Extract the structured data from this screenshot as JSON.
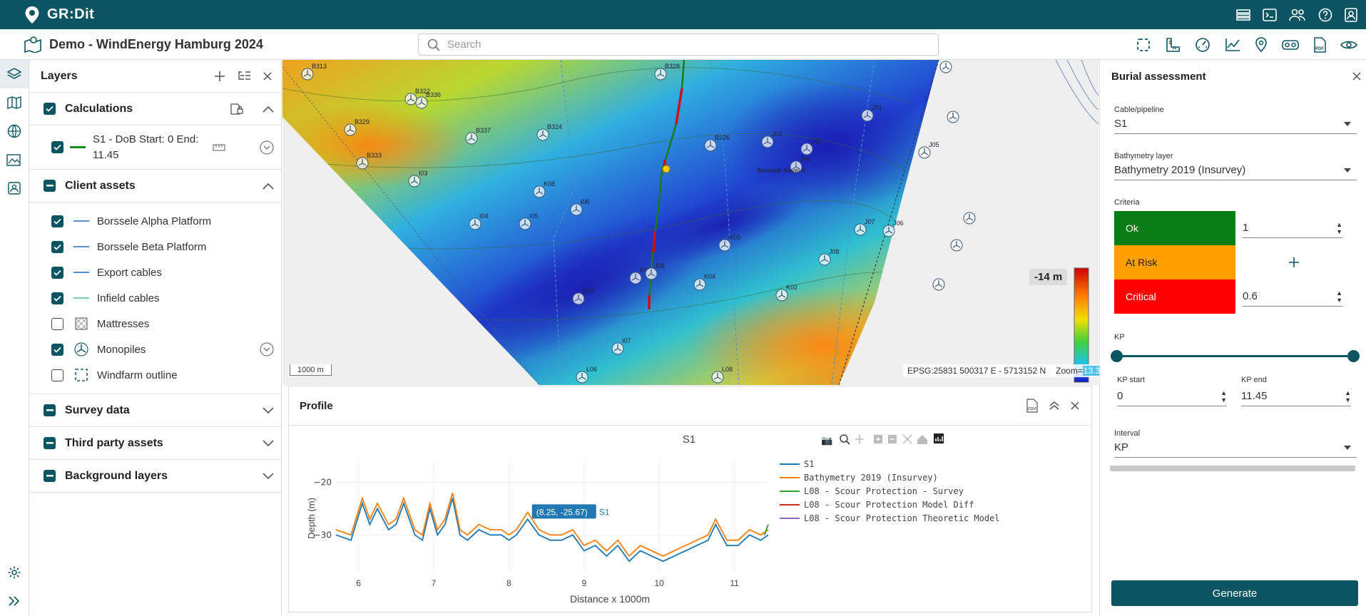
{
  "app": {
    "title": "GR:Dit",
    "project": "Demo - WindEnergy Hamburg 2024"
  },
  "search": {
    "placeholder": "Search"
  },
  "top_icons": [
    "dashboard-icon",
    "terminal-icon",
    "users-icon",
    "help-icon",
    "user-badge-icon"
  ],
  "toolbar_icons": [
    "select-area-icon",
    "ruler-icon",
    "gauge-icon",
    "chart-icon",
    "pin-icon",
    "vr-icon",
    "pdf-icon",
    "eye-icon"
  ],
  "left_rail": [
    "layers-icon",
    "map-icon",
    "globe-icon",
    "gallery-icon",
    "contact-icon",
    "settings-icon",
    "expand-icon"
  ],
  "layers": {
    "title": "Layers",
    "groups": [
      {
        "title": "Calculations",
        "expanded": true,
        "items": [
          {
            "label": "S1 - DoB Start: 0 End: 11.45",
            "checked": true,
            "color": "#1a8a1a"
          }
        ]
      },
      {
        "title": "Client assets",
        "expanded": true,
        "items": [
          {
            "label": "Borssele Alpha Platform",
            "checked": true,
            "color": "#5a8fc7"
          },
          {
            "label": "Borssele Beta Platform",
            "checked": true,
            "color": "#5a8fc7"
          },
          {
            "label": "Export cables",
            "checked": true,
            "color": "#4a90e2"
          },
          {
            "label": "Infield cables",
            "checked": true,
            "color": "#6ed0b0"
          },
          {
            "label": "Mattresses",
            "checked": false
          },
          {
            "label": "Monopiles",
            "checked": true
          },
          {
            "label": "Windfarm outline",
            "checked": false
          }
        ]
      },
      {
        "title": "Survey data",
        "expanded": false
      },
      {
        "title": "Third party assets",
        "expanded": false
      },
      {
        "title": "Background layers",
        "expanded": false
      }
    ]
  },
  "map": {
    "depth_label": "-14 m",
    "scale_label": "1000 m",
    "coords": "EPSG:25831 500317 E - 5713152 N",
    "zoom_label": "Zoom=",
    "zoom_value": "13.3",
    "place_label": "Borssele Kavel II",
    "turbine_labels": [
      "B313",
      "B322",
      "B336",
      "B329",
      "B333",
      "B337",
      "B324",
      "B328",
      "B326",
      "J03",
      "J02",
      "J01",
      "J04",
      "J05",
      "J06",
      "J07",
      "J08",
      "K02",
      "K03",
      "K04",
      "K05",
      "K06",
      "K08",
      "I03",
      "I04",
      "I05",
      "I06",
      "I07",
      "I08",
      "L06",
      "L08"
    ]
  },
  "profile": {
    "title": "Profile",
    "chart_title": "S1",
    "tooltip": "(8.25, -25.67)",
    "tooltip_series": "S1"
  },
  "chart_data": {
    "type": "line",
    "title": "S1",
    "xlabel": "Distance x 1000m",
    "ylabel": "Depth (m)",
    "xlim": [
      5.7,
      11.45
    ],
    "ylim": [
      -37,
      -16
    ],
    "xticks": [
      6,
      7,
      8,
      9,
      10,
      11
    ],
    "yticks": [
      -20,
      -30
    ],
    "legend_position": "right",
    "series": [
      {
        "name": "S1",
        "color": "#1f77b4",
        "x": [
          5.7,
          5.9,
          6.05,
          6.15,
          6.25,
          6.4,
          6.5,
          6.6,
          6.75,
          6.85,
          6.95,
          7.05,
          7.15,
          7.25,
          7.35,
          7.45,
          7.6,
          7.75,
          7.9,
          8.0,
          8.1,
          8.25,
          8.4,
          8.55,
          8.7,
          8.85,
          9.0,
          9.15,
          9.3,
          9.45,
          9.6,
          9.75,
          9.9,
          10.05,
          10.2,
          10.35,
          10.5,
          10.65,
          10.75,
          10.9,
          11.05,
          11.2,
          11.35,
          11.45
        ],
        "y": [
          -30,
          -31,
          -24,
          -28,
          -25,
          -29,
          -28,
          -24,
          -30,
          -31,
          -25,
          -30,
          -28,
          -23,
          -30,
          -31,
          -29,
          -30,
          -30,
          -31,
          -30,
          -27,
          -30,
          -31,
          -31,
          -30,
          -33,
          -32,
          -34,
          -32,
          -35,
          -33,
          -34,
          -35,
          -34,
          -33,
          -32,
          -31,
          -28,
          -32,
          -32,
          -30,
          -31,
          -30
        ]
      },
      {
        "name": "Bathymetry 2019 (Insurvey)",
        "color": "#ff7f0e",
        "x": [
          5.7,
          5.9,
          6.05,
          6.15,
          6.25,
          6.4,
          6.5,
          6.6,
          6.75,
          6.85,
          6.95,
          7.05,
          7.15,
          7.25,
          7.35,
          7.45,
          7.6,
          7.75,
          7.9,
          8.0,
          8.1,
          8.25,
          8.4,
          8.55,
          8.7,
          8.85,
          9.0,
          9.15,
          9.3,
          9.45,
          9.6,
          9.75,
          9.9,
          10.05,
          10.2,
          10.35,
          10.5,
          10.65,
          10.75,
          10.9,
          11.05,
          11.2,
          11.35,
          11.45
        ],
        "y": [
          -29,
          -30,
          -23,
          -27,
          -24,
          -28,
          -27,
          -23,
          -29,
          -30,
          -24,
          -29,
          -27,
          -22,
          -29,
          -30,
          -28,
          -29,
          -29,
          -30,
          -29,
          -25.67,
          -29,
          -30,
          -30,
          -29,
          -32,
          -31,
          -33,
          -31,
          -34,
          -32,
          -33,
          -34,
          -33,
          -32,
          -31,
          -30,
          -27,
          -31,
          -31,
          -29,
          -30,
          -29
        ]
      },
      {
        "name": "L08 - Scour Protection - Survey",
        "color": "#2ca02c",
        "x": [
          11.4,
          11.45
        ],
        "y": [
          -30,
          -28
        ]
      },
      {
        "name": "L08 - Scour Protection Model Diff",
        "color": "#d62728",
        "x": [],
        "y": []
      },
      {
        "name": "L08 - Scour Protection Theoretic Model",
        "color": "#9467bd",
        "x": [],
        "y": []
      }
    ]
  },
  "burial": {
    "title": "Burial assessment",
    "cable_label": "Cable/pipeline",
    "cable_value": "S1",
    "bathy_label": "Bathymetry layer",
    "bathy_value": "Bathymetry 2019 (Insurvey)",
    "criteria_label": "Criteria",
    "criteria": [
      {
        "label": "Ok",
        "color": "#0a7d14",
        "value": "1"
      },
      {
        "label": "At Risk",
        "color": "#ffa000",
        "value": ""
      },
      {
        "label": "Critical",
        "color": "#ff0000",
        "value": "0.6"
      }
    ],
    "kp_label": "KP",
    "kp_start_label": "KP start",
    "kp_start": "0",
    "kp_end_label": "KP end",
    "kp_end": "11.45",
    "interval_label": "Interval",
    "interval_value": "KP",
    "generate_label": "Generate"
  }
}
